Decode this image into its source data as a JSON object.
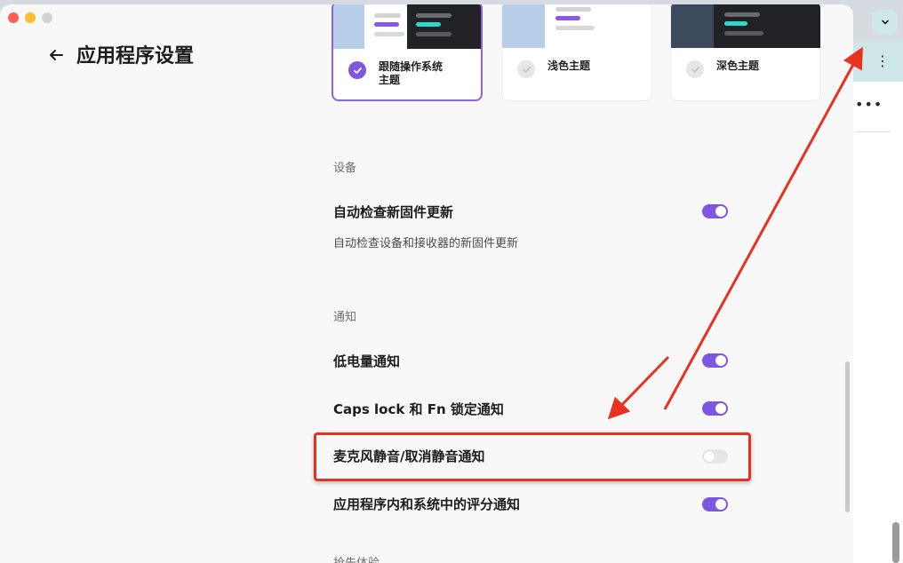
{
  "app": {
    "title": "应用程序设置"
  },
  "themes": [
    {
      "label": "跟随操作系统主题",
      "selected": true
    },
    {
      "label": "浅色主题",
      "selected": false
    },
    {
      "label": "深色主题",
      "selected": false
    }
  ],
  "sections": {
    "device": {
      "label": "设备",
      "firmware_title": "自动检查新固件更新",
      "firmware_desc": "自动检查设备和接收器的新固件更新",
      "firmware_enabled": true
    },
    "notifications": {
      "label": "通知",
      "items": [
        {
          "title": "低电量通知",
          "enabled": true
        },
        {
          "title": "Caps lock 和 Fn 锁定通知",
          "enabled": true
        },
        {
          "title": "麦克风静音/取消静音通知",
          "enabled": false
        },
        {
          "title": "应用程序内和系统中的评分通知",
          "enabled": true
        }
      ]
    },
    "early_access": {
      "label": "抢先体验"
    }
  },
  "colors": {
    "accent": "#7e57e0",
    "toggle_off": "#e6e6e6",
    "annotation": "#e8321f"
  },
  "icons": {
    "back": "arrow-left-icon",
    "check": "check-icon",
    "extension": "chevron-down-icon",
    "menu": "kebab-menu-icon",
    "more": "ellipsis-icon"
  }
}
